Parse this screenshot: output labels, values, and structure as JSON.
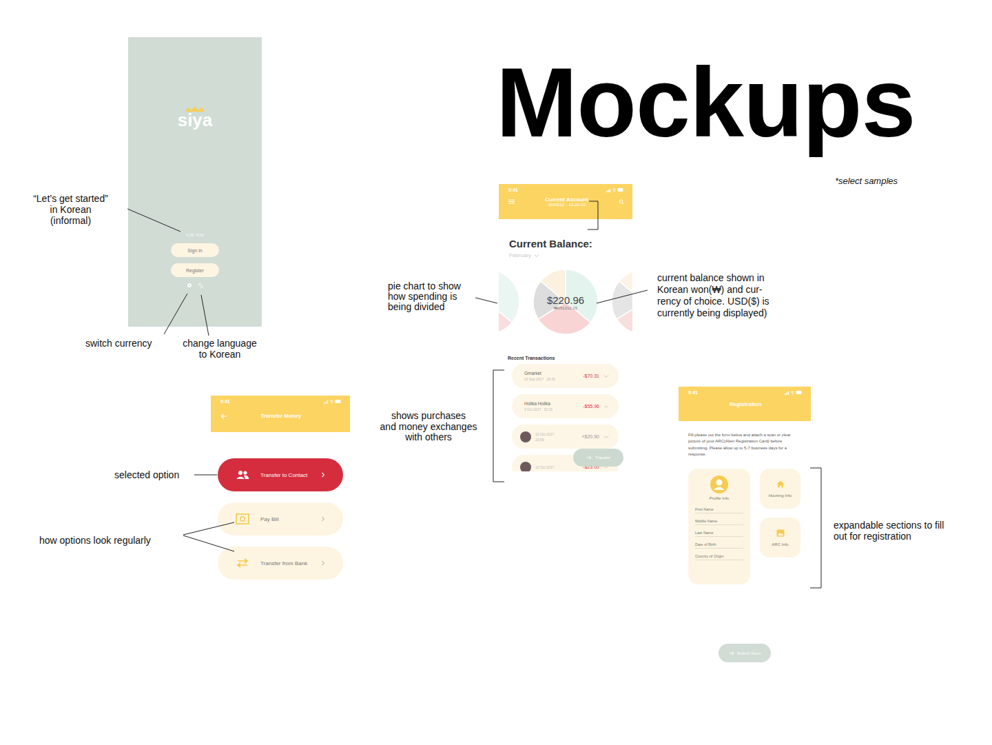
{
  "title": "Mockups",
  "subtitle": "*select samples",
  "splash": {
    "logo": "siya",
    "greeting": "시작 하자",
    "buttons": [
      "Sign in",
      "Register"
    ]
  },
  "transfer_screen": {
    "status_time": "9:41",
    "title": "Transfer Money",
    "options": [
      {
        "label": "Transfer to Contact",
        "kind": "contact",
        "selected": true
      },
      {
        "label": "Pay Bill",
        "kind": "bill",
        "selected": false
      },
      {
        "label": "Transfer from Bank",
        "kind": "bank",
        "selected": false
      }
    ]
  },
  "account_screen": {
    "status_time": "9:41",
    "title": "Current Account",
    "subtitle": "3843312    19-20-10",
    "balance_label": "Current Balance:",
    "month": "February",
    "balance": "$220.96",
    "balance_won": "₩251212.15",
    "pie": [
      {
        "value": 36,
        "color": "#e3f4ee"
      },
      {
        "value": 30,
        "color": "#f8d4d4"
      },
      {
        "value": 20,
        "color": "#dddddd"
      },
      {
        "value": 14,
        "color": "#fcf0de"
      }
    ],
    "recent_title": "Recent Transactions",
    "transactions": [
      {
        "kind": "merchant",
        "name": "Gmarket",
        "date": "22 Sep 2017",
        "time": "23:31",
        "amount": "-$70.31",
        "incoming": false
      },
      {
        "kind": "merchant",
        "name": "Holika Holika",
        "date": "3 Oct 2017",
        "time": "02:15",
        "amount": "-$55.96",
        "incoming": false
      },
      {
        "kind": "contact",
        "date": "12 Oct 2017",
        "time": "23:59",
        "amount": "+$20.90",
        "incoming": true
      },
      {
        "kind": "contact",
        "date": "12 Oct 2017",
        "amount": "-$23.00",
        "incoming": false
      }
    ],
    "transfer_button": "Transfer"
  },
  "registration_screen": {
    "status_time": "9:41",
    "title": "Registration",
    "instructions": "Fill please out the form below and attach a scan or clear picture of your ARC(Alien Registration Card) before submitting. Please allow up to 5-7 business days for a response.",
    "sections": [
      {
        "kind": "profile",
        "label": "Profile Info",
        "expanded": true,
        "fields": [
          "First Name",
          "Middle Name",
          "Last Name",
          "Date of Birth",
          "Country of Origin"
        ]
      },
      {
        "kind": "housing",
        "label": "Housing Info",
        "expanded": false
      },
      {
        "kind": "arc",
        "label": "ARC Info",
        "expanded": false
      }
    ],
    "submit": "Submit Form"
  },
  "annotations": [
    {
      "lines": [
        "“Let’s get started”",
        "in Korean",
        "(informal)"
      ]
    },
    {
      "lines": [
        "switch currency"
      ]
    },
    {
      "lines": [
        "change language",
        "to Korean"
      ]
    },
    {
      "lines": [
        "selected option"
      ]
    },
    {
      "lines": [
        "how options look regularly"
      ]
    },
    {
      "lines": [
        "pie chart to show",
        "how spending is",
        "being divided"
      ]
    },
    {
      "lines": [
        "current balance shown in",
        "Korean won(₩) and cur-",
        "rency of choice. USD($) is",
        "currently being displayed)"
      ]
    },
    {
      "lines": [
        "shows purchases",
        "and money exchanges",
        "with others"
      ]
    },
    {
      "lines": [
        "expandable sections to fill",
        "out for registration"
      ]
    }
  ]
}
